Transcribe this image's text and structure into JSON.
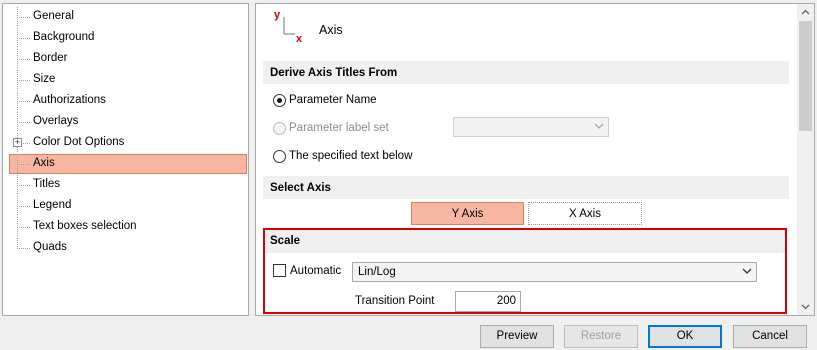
{
  "tree": {
    "items": [
      {
        "label": "General"
      },
      {
        "label": "Background"
      },
      {
        "label": "Border"
      },
      {
        "label": "Size"
      },
      {
        "label": "Authorizations"
      },
      {
        "label": "Overlays"
      },
      {
        "label": "Color Dot Options",
        "expandable": true
      },
      {
        "label": "Axis",
        "selected": true
      },
      {
        "label": "Titles"
      },
      {
        "label": "Legend"
      },
      {
        "label": "Text boxes selection"
      },
      {
        "label": "Quads"
      }
    ]
  },
  "header": {
    "title": "Axis",
    "icon_y": "y",
    "icon_x": "x",
    "icon": "axis-icon"
  },
  "derive": {
    "title": "Derive Axis Titles From",
    "options": [
      {
        "label": "Parameter Name",
        "checked": true
      },
      {
        "label": "Parameter label set",
        "disabled": true
      },
      {
        "label": "The specified text below"
      }
    ],
    "label_set_value": ""
  },
  "select_axis": {
    "title": "Select Axis",
    "tabs": [
      {
        "label": "Y Axis",
        "active": true
      },
      {
        "label": "X Axis"
      }
    ]
  },
  "scale": {
    "title": "Scale",
    "automatic_label": "Automatic",
    "automatic_checked": false,
    "type_value": "Lin/Log",
    "transition_label": "Transition Point",
    "transition_value": "200"
  },
  "buttons": {
    "preview": "Preview",
    "restore": "Restore",
    "ok": "OK",
    "cancel": "Cancel"
  },
  "colors": {
    "selection": "#f7b6a1",
    "highlight_border": "#d80000",
    "axis_y": "#c00000",
    "axis_x": "#e00000"
  }
}
